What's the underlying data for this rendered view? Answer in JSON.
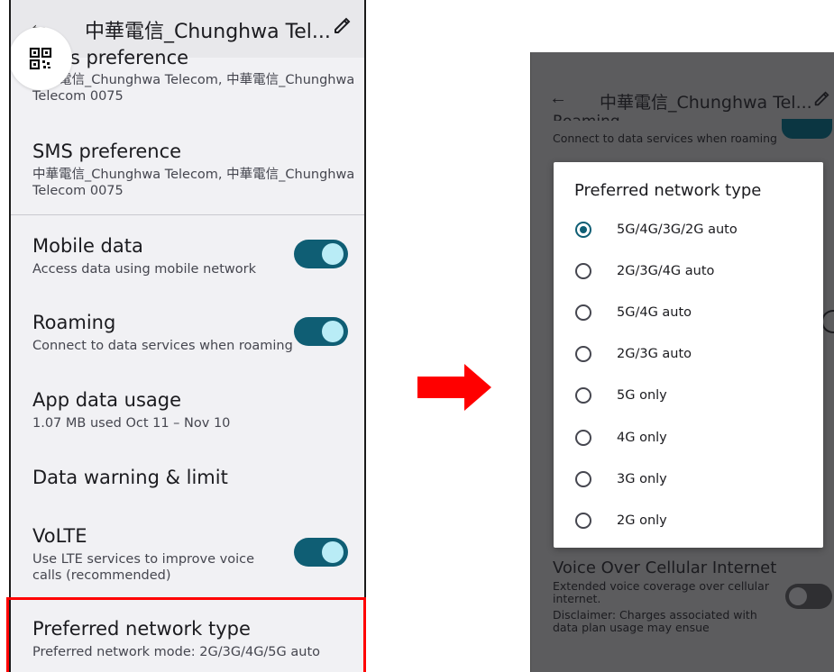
{
  "left_screen": {
    "title": "中華電信_Chunghwa Tel...",
    "partial_item": {
      "title": "Calls preference",
      "visible_title": "ls preference",
      "subtitle": "中華電信_Chunghwa Telecom, 中華電信_Chunghwa Telecom 0075"
    },
    "items": [
      {
        "title": "SMS preference",
        "subtitle": "中華電信_Chunghwa Telecom, 中華電信_Chunghwa Telecom 0075"
      },
      {
        "title": "Mobile data",
        "subtitle": "Access data using mobile network",
        "toggle": true
      },
      {
        "title": "Roaming",
        "subtitle": "Connect to data services when roaming",
        "toggle": true
      },
      {
        "title": "App data usage",
        "subtitle": "1.07 MB used Oct 11 – Nov 10"
      },
      {
        "title": "Data warning & limit",
        "subtitle": ""
      },
      {
        "title": "VoLTE",
        "subtitle": "Use LTE services to improve voice calls (recommended)",
        "toggle": true
      },
      {
        "title": "Preferred network type",
        "subtitle": "Preferred network mode: 2G/3G/4G/5G auto",
        "highlighted": true
      }
    ]
  },
  "right_screen": {
    "title": "中華電信_Chunghwa Tel...",
    "bg_partial_title": "Roaming",
    "bg_partial_subtitle": "Connect to data services when roaming",
    "bg_voice_title": "Voice Over Cellular Internet",
    "bg_voice_subtitle": "Extended voice coverage over cellular internet.",
    "bg_disclaimer": "Disclaimer: Charges associated with data plan usage may ensue",
    "dialog": {
      "title": "Preferred network type",
      "options": [
        {
          "label": "5G/4G/3G/2G auto",
          "selected": true
        },
        {
          "label": "2G/3G/4G auto",
          "selected": false
        },
        {
          "label": "5G/4G auto",
          "selected": false
        },
        {
          "label": "2G/3G auto",
          "selected": false
        },
        {
          "label": "5G only",
          "selected": false
        },
        {
          "label": "4G only",
          "selected": false
        },
        {
          "label": "3G only",
          "selected": false
        },
        {
          "label": "2G only",
          "selected": false
        }
      ]
    }
  },
  "colors": {
    "accent": "#0f5e74",
    "toggle_knob": "#b9ecf6",
    "highlight": "#ff0000",
    "arrow": "#ff0000"
  },
  "icons": [
    "back-arrow-icon",
    "edit-pencil-icon",
    "qr-code-icon",
    "right-arrow-icon"
  ]
}
